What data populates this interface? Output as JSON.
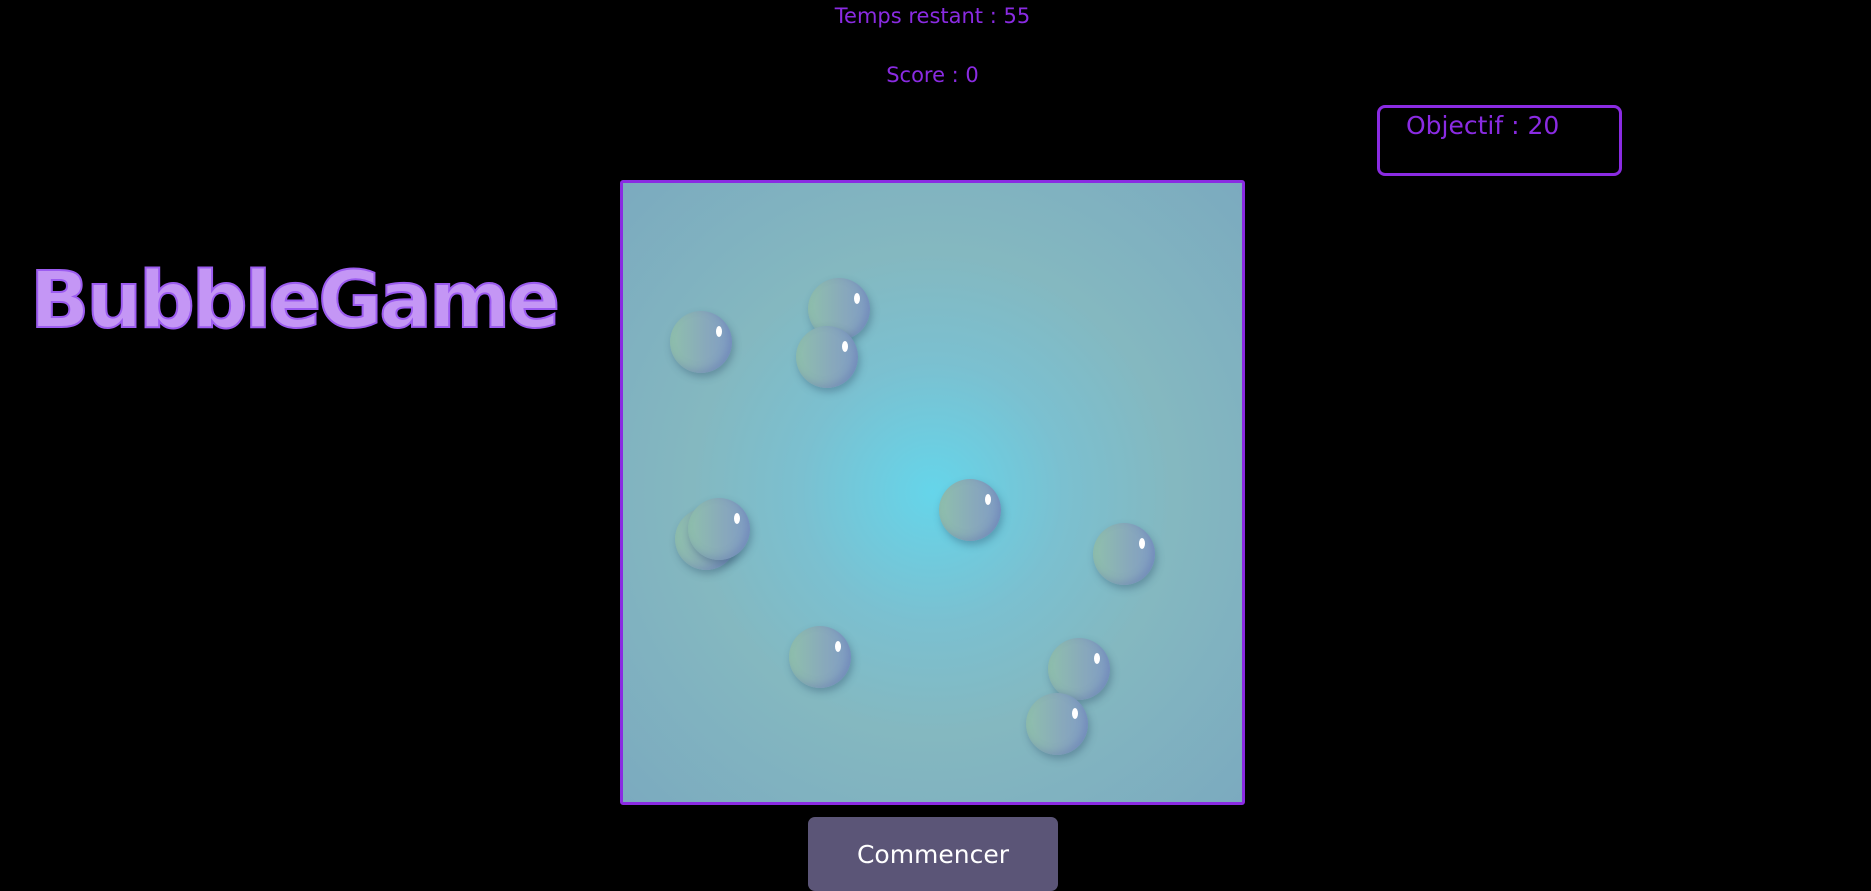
{
  "hud": {
    "timer_text": "Temps restant : 55",
    "score_text": "Score : 0",
    "objective_text": "Objectif : 20"
  },
  "logo": {
    "text": "BubbleGame"
  },
  "board": {
    "bubble_count": 11
  },
  "controls": {
    "start_label": "Commencer"
  },
  "colors": {
    "accent": "#8a2be2",
    "logo_fill": "#c496f5",
    "background": "#000000",
    "button": "#5b5577"
  }
}
